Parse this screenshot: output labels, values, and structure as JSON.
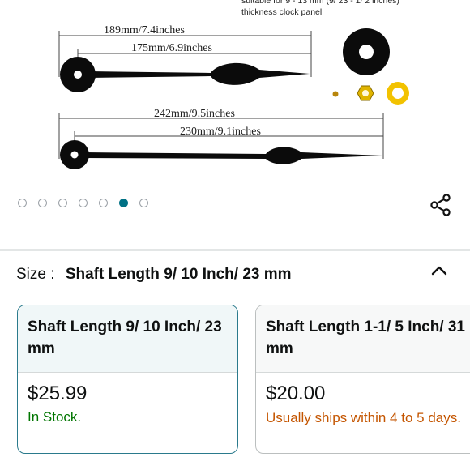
{
  "product_image": {
    "caption_line1": "suitable for 9 - 13 mm (9/ 23 - 1/ 2 inches)",
    "caption_line2": "thickness clock panel",
    "hour_hand_total": "189mm/7.4inches",
    "hour_hand_length": "175mm/6.9inches",
    "minute_hand_total": "242mm/9.5inches",
    "minute_hand_length": "230mm/9.1inches"
  },
  "carousel": {
    "dot_count": 7,
    "active_index": 5,
    "active_color": "#007185"
  },
  "share_icon": "share-icon",
  "size_selector": {
    "label": "Size :",
    "selected_value": "Shaft Length 9/ 10 Inch/ 23 mm",
    "toggle_icon": "chevron-up-icon"
  },
  "options": [
    {
      "title": "Shaft Length 9/ 10 Inch/ 23 mm",
      "price": "$25.99",
      "availability": "In Stock.",
      "selected": true
    },
    {
      "title": "Shaft Length 1-1/ 5 Inch/ 31 mm",
      "price": "$20.00",
      "availability": "Usually ships within 4 to 5 days.",
      "selected": false
    }
  ],
  "colors": {
    "selected_border": "#2a7a8c",
    "in_stock": "#007600",
    "ships_later": "#c45500"
  }
}
